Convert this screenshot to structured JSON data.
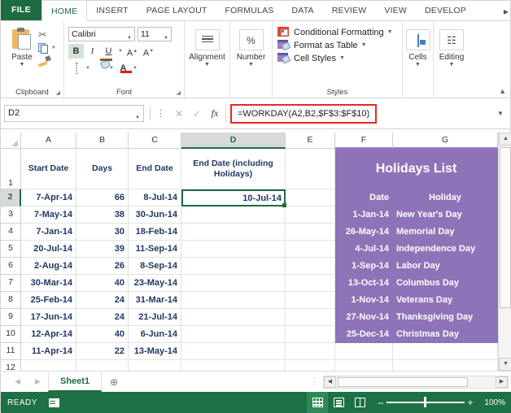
{
  "ribbon_tabs": [
    {
      "label": "FILE",
      "id": "file"
    },
    {
      "label": "HOME",
      "id": "home"
    },
    {
      "label": "INSERT",
      "id": "insert"
    },
    {
      "label": "PAGE LAYOUT",
      "id": "page-layout"
    },
    {
      "label": "FORMULAS",
      "id": "formulas"
    },
    {
      "label": "DATA",
      "id": "data"
    },
    {
      "label": "REVIEW",
      "id": "review"
    },
    {
      "label": "VIEW",
      "id": "view"
    },
    {
      "label": "DEVELOP",
      "id": "developer"
    }
  ],
  "ribbon": {
    "clipboard": {
      "group_label": "Clipboard",
      "paste_label": "Paste",
      "cut_icon": "scissors-icon",
      "copy_icon": "copy-icon",
      "format_painter_icon": "format-painter-icon"
    },
    "font": {
      "group_label": "Font",
      "font_name": "Calibri",
      "font_size": "11",
      "bold_label": "B",
      "italic_label": "I",
      "underline_label": "U",
      "grow_label": "A",
      "shrink_label": "A",
      "borders_icon": "borders-icon",
      "fill_color_icon": "fill-color-icon",
      "font_color_icon": "font-color-icon"
    },
    "alignment": {
      "group_label": "Alignment",
      "icon": "alignment-icon"
    },
    "number": {
      "group_label": "Number",
      "icon": "percent-icon",
      "symbol": "%"
    },
    "styles": {
      "group_label": "Styles",
      "items": [
        {
          "label": "Conditional Formatting",
          "icon": "conditional-formatting-icon"
        },
        {
          "label": "Format as Table",
          "icon": "format-as-table-icon"
        },
        {
          "label": "Cell Styles",
          "icon": "cell-styles-icon"
        }
      ]
    },
    "cells": {
      "group_label": "Cells",
      "icon": "cells-icon"
    },
    "editing": {
      "group_label": "Editing",
      "icon": "binoculars-icon"
    }
  },
  "formula_bar": {
    "name_box": "D2",
    "cancel_icon": "cancel-icon",
    "enter_icon": "enter-icon",
    "function_icon": "fx",
    "formula": "=WORKDAY(A2,B2,$F$3:$F$10)",
    "highlight_color": "#ef2424"
  },
  "grid": {
    "column_headers": [
      "A",
      "B",
      "C",
      "D",
      "E",
      "F",
      "G"
    ],
    "selected_column": "D",
    "row_numbers": [
      "1",
      "2",
      "3",
      "4",
      "5",
      "6",
      "7",
      "8",
      "9",
      "10",
      "11",
      "12"
    ],
    "selected_row": "2",
    "headers": {
      "a": "Start Date",
      "b": "Days",
      "c": "End Date",
      "d": "End Date (including Holidays)"
    },
    "rows": [
      {
        "start": "7-Apr-14",
        "days": "66",
        "end": "8-Jul-14"
      },
      {
        "start": "7-May-14",
        "days": "38",
        "end": "30-Jun-14"
      },
      {
        "start": "7-Jan-14",
        "days": "30",
        "end": "18-Feb-14"
      },
      {
        "start": "20-Jul-14",
        "days": "39",
        "end": "11-Sep-14"
      },
      {
        "start": "2-Aug-14",
        "days": "26",
        "end": "8-Sep-14"
      },
      {
        "start": "30-Mar-14",
        "days": "40",
        "end": "23-May-14"
      },
      {
        "start": "25-Feb-14",
        "days": "24",
        "end": "31-Mar-14"
      },
      {
        "start": "17-Jun-14",
        "days": "24",
        "end": "21-Jul-14"
      },
      {
        "start": "12-Apr-14",
        "days": "40",
        "end": "6-Jun-14"
      },
      {
        "start": "11-Apr-14",
        "days": "22",
        "end": "13-May-14"
      }
    ],
    "selected_cell_value": "10-Jul-14"
  },
  "holidays": {
    "title": "Holidays List",
    "col_date": "Date",
    "col_holiday": "Holiday",
    "bg_color": "#8f73b8",
    "items": [
      {
        "date": "1-Jan-14",
        "name": "New Year's Day"
      },
      {
        "date": "26-May-14",
        "name": "Memorial Day"
      },
      {
        "date": "4-Jul-14",
        "name": "Independence Day"
      },
      {
        "date": "1-Sep-14",
        "name": "Labor Day"
      },
      {
        "date": "13-Oct-14",
        "name": "Columbus Day"
      },
      {
        "date": "1-Nov-14",
        "name": "Veterans Day"
      },
      {
        "date": "27-Nov-14",
        "name": "Thanksgiving Day"
      },
      {
        "date": "25-Dec-14",
        "name": "Christmas Day"
      }
    ]
  },
  "sheet_tabs": {
    "tabs": [
      "Sheet1"
    ],
    "add_label": "+"
  },
  "status_bar": {
    "status": "READY",
    "macro_icon": "macro-record-icon",
    "view_normal_icon": "normal-view-icon",
    "view_layout_icon": "page-layout-view-icon",
    "view_break_icon": "page-break-view-icon",
    "zoom_out": "–",
    "zoom_in": "+",
    "zoom_level": "100%"
  }
}
